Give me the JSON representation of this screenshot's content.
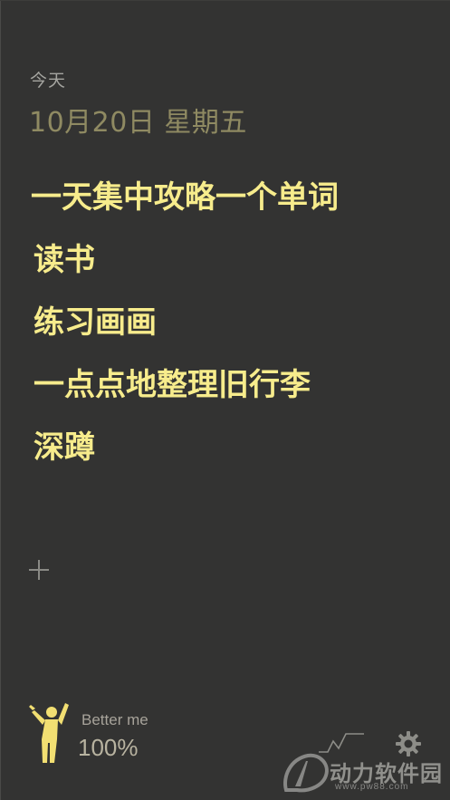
{
  "header": {
    "day_label": "今天",
    "date_label": "10月20日 星期五"
  },
  "tasks": [
    {
      "label": "一天集中攻略一个单词"
    },
    {
      "label": "读书"
    },
    {
      "label": "练习画画"
    },
    {
      "label": "一点点地整理旧行李"
    },
    {
      "label": "深蹲"
    }
  ],
  "footer": {
    "brand_name": "Better me",
    "progress_text": "100%",
    "progress_value": 100
  },
  "icons": {
    "add": "plus-icon",
    "figure": "cheering-person-icon",
    "chart": "trend-chart-icon",
    "settings": "gear-icon"
  },
  "watermark": {
    "text": "动力软件园",
    "url": "www.pw88.com"
  },
  "colors": {
    "background": "#333332",
    "task_text": "#f7ec8c",
    "date_text": "#8f8a62",
    "muted_text": "#a5a5a0"
  }
}
